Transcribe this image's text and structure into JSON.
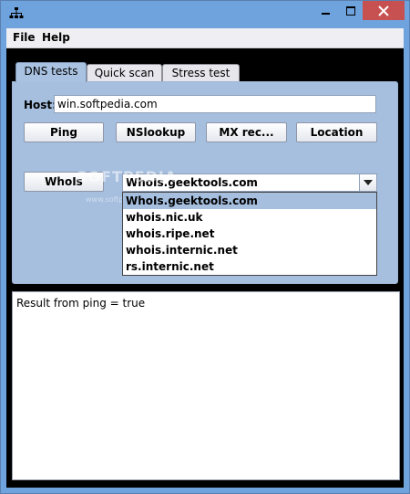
{
  "window": {
    "title": ""
  },
  "menu": {
    "file": "File",
    "help": "Help"
  },
  "tabs": {
    "dns": "DNS tests",
    "quick": "Quick scan",
    "stress": "Stress test"
  },
  "dns_panel": {
    "host_label": "Host:",
    "host_value": "win.softpedia.com",
    "ping": "Ping",
    "nslookup": "NSlookup",
    "mx": "MX rec...",
    "location": "Location",
    "whois": "WhoIs",
    "whois_server": "WhoIs.geektools.com",
    "whois_servers": [
      "WhoIs.geektools.com",
      "whois.nic.uk",
      "whois.ripe.net",
      "whois.internic.net",
      "rs.internic.net"
    ]
  },
  "watermark": {
    "main": "SOFTPEDIA",
    "sub": "www.softpedia.com"
  },
  "result": {
    "text": "Result from ping = true"
  },
  "colors": {
    "close": "#c75050",
    "panel": "#a6bfdf",
    "titlebar": "#6ea3dd"
  }
}
